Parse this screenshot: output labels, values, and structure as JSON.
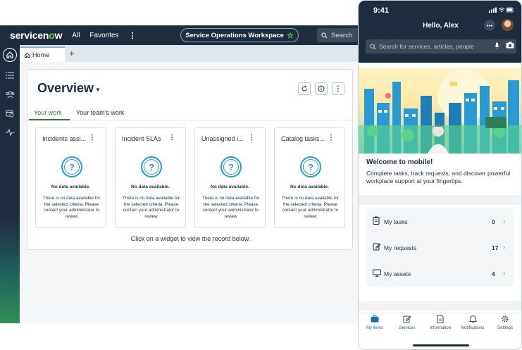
{
  "desktop": {
    "logo": {
      "text_a": "servicen",
      "text_o": "o",
      "text_b": "w"
    },
    "nav": {
      "all": "All",
      "favorites": "Favorites",
      "more": "⋮"
    },
    "workspace_pill": "Service Operations Workspace",
    "search_label": "Search",
    "tabs": {
      "home_label": "Home",
      "add_label": "+"
    },
    "overview": {
      "title": "Overview",
      "tab_your_work": "Your work",
      "tab_team_work": "Your team's work",
      "widgets": [
        {
          "title": "Incidents assi...",
          "no_data": "No data available.",
          "message": "There is no data available for the selected criteria. Please contact your administrator to review"
        },
        {
          "title": "Incident SLAs",
          "no_data": "No data available.",
          "message": "There is no data available for the selected criteria. Please contact your administrator to review"
        },
        {
          "title": "Unassigned i...",
          "no_data": "No data available.",
          "message": "There is no data available for the selected criteria. Please contact your administrator to review"
        },
        {
          "title": "Catalog tasks...",
          "no_data": "No data available.",
          "message": "There is no data available for the selected criteria. Please contact your administrator to review"
        }
      ],
      "hint": "Click on a widget to view the record below."
    },
    "colors": {
      "navy": "#1d2d3e",
      "brand_green": "#62d84e",
      "accent_blue": "#2a9bd2",
      "tab_green": "#2e7d32"
    }
  },
  "mobile": {
    "time": "9:41",
    "greeting": "Hello, Alex",
    "more_label": "•••",
    "search_placeholder": "Search for services, articles, people",
    "welcome_title": "Welcome to mobile!",
    "welcome_desc": "Complete tasks, track requests, and discover powerful workplace support at your fingertips.",
    "items": [
      {
        "label": "My tasks",
        "count": "0",
        "icon": "clipboard-icon"
      },
      {
        "label": "My requests",
        "count": "17",
        "icon": "edit-icon"
      },
      {
        "label": "My assets",
        "count": "4",
        "icon": "monitor-icon"
      }
    ],
    "tabs": [
      {
        "label": "My items",
        "icon": "briefcase-icon",
        "active": true
      },
      {
        "label": "Services",
        "icon": "pencil-icon",
        "active": false
      },
      {
        "label": "Information",
        "icon": "document-icon",
        "active": false
      },
      {
        "label": "Notifications",
        "icon": "bell-icon",
        "active": false
      },
      {
        "label": "Settings",
        "icon": "gear-icon",
        "active": false
      }
    ]
  }
}
